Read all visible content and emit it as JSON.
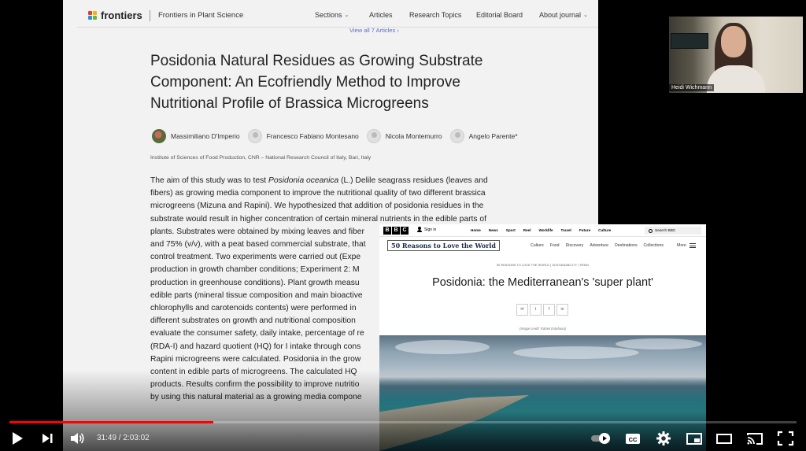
{
  "article": {
    "header": {
      "logo": "frontiers",
      "journal": "Frontiers in Plant Science",
      "nav": [
        "Sections",
        "Articles",
        "Research Topics",
        "Editorial Board",
        "About journal"
      ],
      "view_all": "View all 7 Articles"
    },
    "title_lines": [
      "Posidonia Natural Residues as Growing Substrate",
      "Component: An Ecofriendly Method to Improve",
      "Nutritional Profile of Brassica Microgreens"
    ],
    "authors": [
      "Massimiliano D'Imperio",
      "Francesco Fabiano Montesano",
      "Nicola Montemurro",
      "Angelo Parente*"
    ],
    "institute": "Institute of Sciences of Food Production, CNR – National Research Council of Italy, Bari, Italy",
    "abstract_lines": [
      "The aim of this study was to test Posidonia oceanica (L.) Delile seagrass residues (leaves and",
      "fibers) as growing media component to improve the nutritional quality of two different brassica",
      "microgreens (Mizuna and Rapini). We hypothesized that addition of posidonia residues in the",
      "substrate would result in higher concentration of certain mineral nutrients in the edible parts of",
      "plants. Substrates were obtained by mixing leaves and fiber",
      "and 75% (v/v), with a peat based commercial substrate, that",
      "control treatment. Two experiments were carried out (Expe",
      "production in growth chamber conditions; Experiment 2: M",
      "production in greenhouse conditions). Plant growth measu",
      "edible parts (mineral tissue composition and main bioactive",
      "chlorophylls and carotenoids contents) were performed in",
      "different substrates on growth and nutritional composition",
      "evaluate the consumer safety, daily intake, percentage of re",
      "(RDA-I) and hazard quotient (HQ) for I intake through cons",
      "Rapini microgreens were calculated. Posidonia in the grow",
      "content in edible parts of microgreens. The calculated HQ",
      "products. Results confirm the possibility to improve nutritio",
      "by using this natural material as a growing media compone"
    ]
  },
  "bbc": {
    "logo": [
      "B",
      "B",
      "C"
    ],
    "sign_in": "Sign in",
    "top_nav": [
      "Home",
      "News",
      "Sport",
      "Reel",
      "Worklife",
      "Travel",
      "Future",
      "Culture"
    ],
    "search": "Search BBC",
    "brand": "50 Reasons to Love the World",
    "sub_nav": [
      "Culture",
      "Food",
      "Discovery",
      "Adventure",
      "Destinations",
      "Collections"
    ],
    "more": "More",
    "kicker": "50 REASONS TO LOVE THE WORLD | SUSTAINABILITY | SPAIN",
    "headline": "Posidonia: the Mediterranean's 'super plant'",
    "share": [
      "✉",
      "t",
      "f",
      "in"
    ],
    "credit": "(Image credit: Rafael Estefania)"
  },
  "webcam": {
    "name": "Heidi Wichmann"
  },
  "player": {
    "current_time": "31:49",
    "duration": "2:03:02",
    "progress": 0.2586,
    "cc_label": "CC",
    "accent": "#ff0000"
  }
}
